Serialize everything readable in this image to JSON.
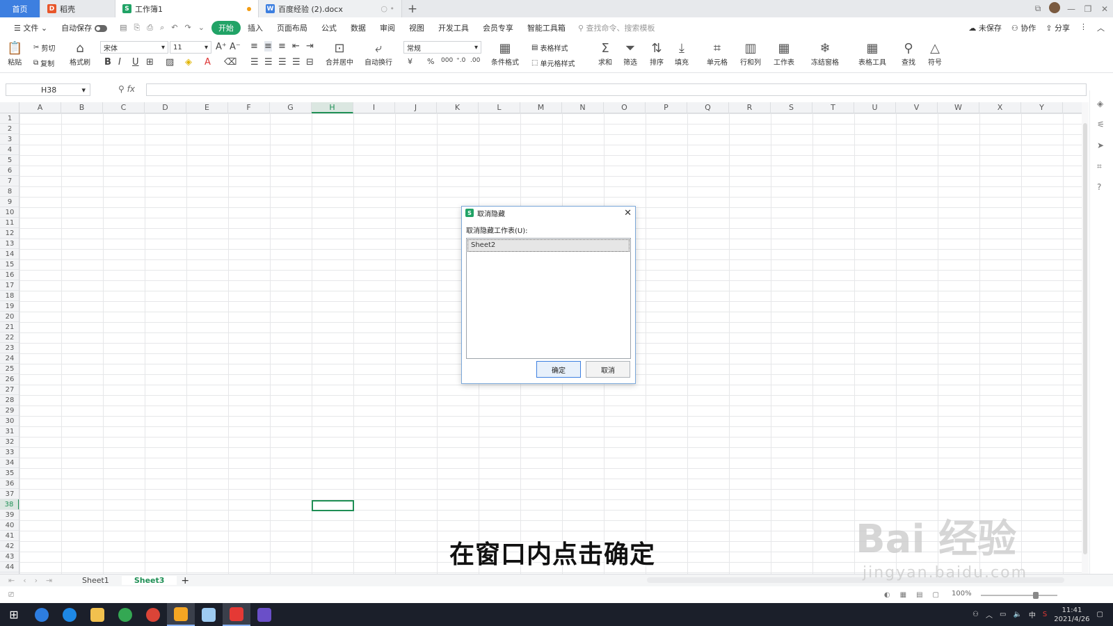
{
  "tabs": {
    "home": "首页",
    "wps": "稻壳",
    "workbook": "工作簿1",
    "doc": "百度经验 (2).docx",
    "new_tab": "+"
  },
  "menubar": {
    "file": "文件",
    "autosave": "自动保存",
    "items": [
      "开始",
      "插入",
      "页面布局",
      "公式",
      "数据",
      "审阅",
      "视图",
      "开发工具",
      "会员专享",
      "智能工具箱"
    ],
    "search_placeholder": "查找命令、搜索模板",
    "unsaved": "未保存",
    "collaborate": "协作",
    "share": "分享"
  },
  "ribbon": {
    "cut": "剪切",
    "paste": "粘贴",
    "copy": "复制",
    "format_painter": "格式刷",
    "font_name": "宋体",
    "font_size": "11",
    "merge_center": "合并居中",
    "auto_wrap": "自动换行",
    "number_format": "常规",
    "conditional_format": "条件格式",
    "table_style": "表格样式",
    "cell_style": "单元格样式",
    "sum": "求和",
    "filter": "筛选",
    "sort": "排序",
    "fill": "填充",
    "cell": "单元格",
    "row_col": "行和列",
    "worksheet": "工作表",
    "freeze": "冻结窗格",
    "table_tools": "表格工具",
    "find": "查找",
    "symbol": "符号"
  },
  "formula_bar": {
    "name_box": "H38",
    "fx": "fx",
    "formula": ""
  },
  "grid": {
    "columns": [
      "A",
      "B",
      "C",
      "D",
      "E",
      "F",
      "G",
      "H",
      "I",
      "J",
      "K",
      "L",
      "M",
      "N",
      "O",
      "P",
      "Q",
      "R",
      "S",
      "T",
      "U",
      "V",
      "W",
      "X",
      "Y"
    ],
    "selected_column": "H",
    "selected_row": 38,
    "row_count": 44
  },
  "sheets": {
    "items": [
      "Sheet1",
      "Sheet3"
    ],
    "active": "Sheet3",
    "add": "+"
  },
  "status": {
    "zoom": "100%"
  },
  "dialog": {
    "title": "取消隐藏",
    "label": "取消隐藏工作表(U):",
    "list_items": [
      "Sheet2"
    ],
    "ok": "确定",
    "cancel": "取消"
  },
  "overlay": {
    "subtitle": "在窗口内点击确定",
    "watermark_main": "Bai 经验",
    "watermark_url": "jingyan.baidu.com"
  },
  "taskbar": {
    "time": "11:41",
    "date": "2021/4/26",
    "ime": "中"
  },
  "colors": {
    "accent_green": "#21a366",
    "tab_blue": "#3d7fe0",
    "selection_green": "#1f8f55"
  }
}
